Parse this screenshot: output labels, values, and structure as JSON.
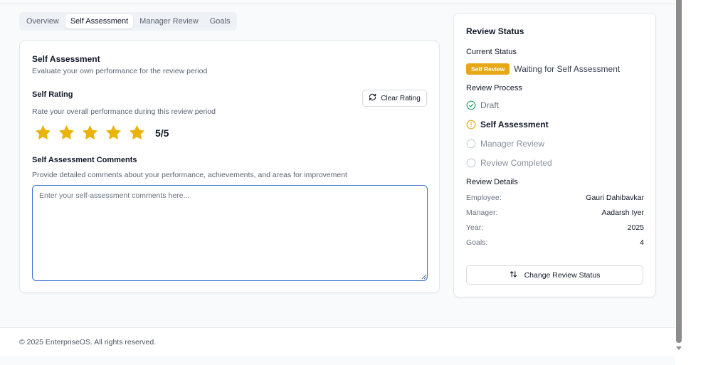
{
  "tabs": [
    {
      "label": "Overview",
      "active": false
    },
    {
      "label": "Self Assessment",
      "active": true
    },
    {
      "label": "Manager Review",
      "active": false
    },
    {
      "label": "Goals",
      "active": false
    }
  ],
  "self_assessment": {
    "title": "Self Assessment",
    "subtitle": "Evaluate your own performance for the review period",
    "rating": {
      "title": "Self Rating",
      "description": "Rate your overall performance during this review period",
      "clear_label": "Clear Rating",
      "value": 5,
      "max": 5,
      "display": "5/5",
      "star_color": "#eab308"
    },
    "comments": {
      "title": "Self Assessment Comments",
      "description": "Provide detailed comments about your performance, achievements, and areas for improvement",
      "placeholder": "Enter your self-assessment comments here...",
      "value": ""
    }
  },
  "review_status": {
    "title": "Review Status",
    "current_status_label": "Current Status",
    "badge": "Self Review",
    "badge_color": "#e6a817",
    "status_text": "Waiting for Self Assessment",
    "process_label": "Review Process",
    "steps": [
      {
        "label": "Draft",
        "state": "done",
        "icon": "check-circle-icon"
      },
      {
        "label": "Self Assessment",
        "state": "current",
        "icon": "alert-circle-icon"
      },
      {
        "label": "Manager Review",
        "state": "pending",
        "icon": "empty-circle-icon"
      },
      {
        "label": "Review Completed",
        "state": "pending",
        "icon": "empty-circle-icon"
      }
    ],
    "details_label": "Review Details",
    "details": [
      {
        "label": "Employee:",
        "value": "Gauri Dahibavkar"
      },
      {
        "label": "Manager:",
        "value": "Aadarsh Iyer"
      },
      {
        "label": "Year:",
        "value": "2025"
      },
      {
        "label": "Goals:",
        "value": "4"
      }
    ],
    "change_button_label": "Change Review Status"
  },
  "footer": {
    "text": "© 2025 EnterpriseOS. All rights reserved."
  },
  "colors": {
    "accent_focus": "#3b6fd4",
    "done_green": "#22a36a",
    "current_amber": "#e6a817"
  }
}
